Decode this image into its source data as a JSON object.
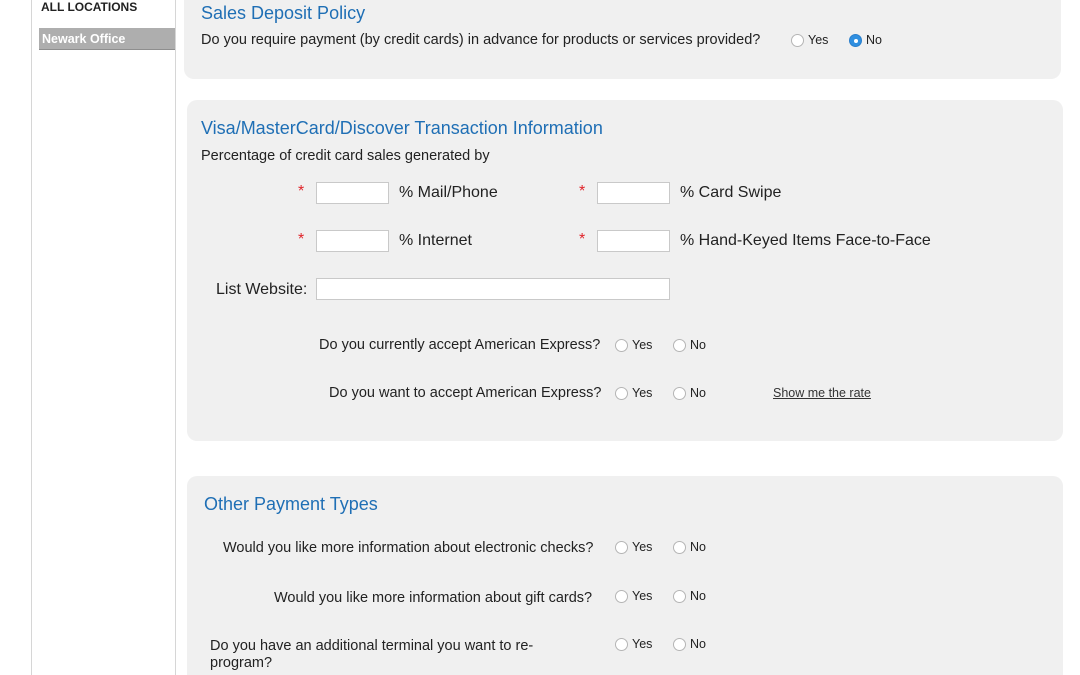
{
  "sidebar": {
    "all_locations": "ALL LOCATIONS",
    "selected_location": "Newark Office"
  },
  "deposit": {
    "title": "Sales Deposit Policy",
    "question": "Do you require payment (by credit cards) in advance for products or services provided?",
    "yes": "Yes",
    "no": "No",
    "selected": "No"
  },
  "visa": {
    "title": "Visa/MasterCard/Discover Transaction Information",
    "subtitle": "Percentage of credit card sales generated by",
    "required_mark": "*",
    "mail_phone": "% Mail/Phone",
    "card_swipe": "% Card Swipe",
    "internet": "% Internet",
    "hand_keyed": "% Hand-Keyed Items Face-to-Face",
    "website_label": "List Website:",
    "amex_current": "Do you currently accept American Express?",
    "amex_want": "Do you want to accept American Express?",
    "yes": "Yes",
    "no": "No",
    "rate_link": "Show me the rate"
  },
  "other": {
    "title": "Other Payment Types",
    "echecks": "Would you like more information about electronic checks?",
    "gift_cards": "Would you like more information about gift cards?",
    "terminal": "Do you have an additional terminal you want to re-program?",
    "yes": "Yes",
    "no": "No"
  }
}
